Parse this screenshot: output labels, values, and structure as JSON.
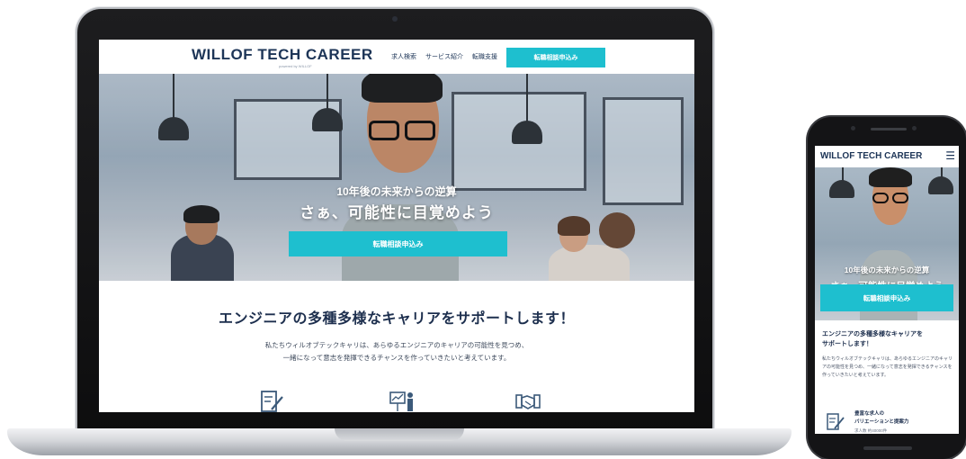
{
  "desktop": {
    "header": {
      "logo": "WILLOF TECH CAREER",
      "logo_sub": "powered by WILLOF",
      "nav": [
        "求人検索",
        "サービス紹介",
        "転職支援"
      ],
      "cta": "転職相談申込み"
    },
    "hero": {
      "subtitle": "10年後の未来からの逆算",
      "title": "さぁ、可能性に目覚めよう",
      "button": "転職相談申込み"
    },
    "section": {
      "title": "エンジニアの多種多様なキャリアをサポートします！",
      "text_line1": "私たちウィルオブテックキャリは、あらゆるエンジニアのキャリアの可能性を見つめ、",
      "text_line2": "一緒になって意志を発揮できるチャンスを作っていきたいと考えています。",
      "icons": [
        "document-pen-icon",
        "presentation-icon",
        "handshake-icon"
      ]
    }
  },
  "mobile": {
    "header": {
      "logo": "WILLOF TECH CAREER",
      "menu_icon": "hamburger-menu-icon"
    },
    "hero": {
      "subtitle": "10年後の未来からの逆算",
      "title": "さぁ、可能性に目覚めよう",
      "button": "転職相談申込み"
    },
    "section": {
      "title_line1": "エンジニアの多種多様なキャリアを",
      "title_line2": "サポートします！",
      "text": "私たちウィルオブテックキャリは、あらゆるエンジニアのキャリアの可能性を見つめ、一緒になって意志を発揮できるチャンスを作っていきたいと考えています。"
    },
    "feature": {
      "title_line1": "豊富な求人の",
      "title_line2": "バリエーションと提案力",
      "note": "求人数 約40000件"
    }
  },
  "colors": {
    "accent": "#1ebfcf",
    "navy": "#1d3557",
    "device_body": "#141416"
  }
}
